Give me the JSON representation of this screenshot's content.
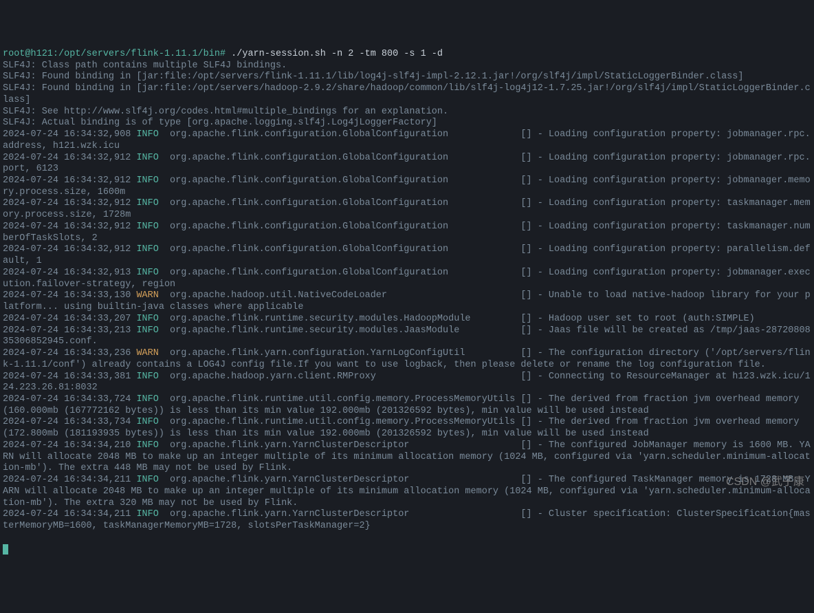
{
  "prompt_prefix": "root@h121:/opt/servers/flink-1.11.1/bin# ",
  "prompt_cmd": "./yarn-session.sh -n 2 -tm 800 -s 1 -d",
  "slf4j": [
    "SLF4J: Class path contains multiple SLF4J bindings.",
    "SLF4J: Found binding in [jar:file:/opt/servers/flink-1.11.1/lib/log4j-slf4j-impl-2.12.1.jar!/org/slf4j/impl/StaticLoggerBinder.class]",
    "SLF4J: Found binding in [jar:file:/opt/servers/hadoop-2.9.2/share/hadoop/common/lib/slf4j-log4j12-1.7.25.jar!/org/slf4j/impl/StaticLoggerBinder.class]",
    "SLF4J: See http://www.slf4j.org/codes.html#multiple_bindings for an explanation.",
    "SLF4J: Actual binding is of type [org.apache.logging.slf4j.Log4jLoggerFactory]"
  ],
  "logs": [
    {
      "ts": "2024-07-24 16:34:32,908",
      "lvl": "INFO",
      "logger": "org.apache.flink.configuration.GlobalConfiguration",
      "msg": "[] - Loading configuration property: jobmanager.rpc.address, h121.wzk.icu"
    },
    {
      "ts": "2024-07-24 16:34:32,912",
      "lvl": "INFO",
      "logger": "org.apache.flink.configuration.GlobalConfiguration",
      "msg": "[] - Loading configuration property: jobmanager.rpc.port, 6123"
    },
    {
      "ts": "2024-07-24 16:34:32,912",
      "lvl": "INFO",
      "logger": "org.apache.flink.configuration.GlobalConfiguration",
      "msg": "[] - Loading configuration property: jobmanager.memory.process.size, 1600m"
    },
    {
      "ts": "2024-07-24 16:34:32,912",
      "lvl": "INFO",
      "logger": "org.apache.flink.configuration.GlobalConfiguration",
      "msg": "[] - Loading configuration property: taskmanager.memory.process.size, 1728m"
    },
    {
      "ts": "2024-07-24 16:34:32,912",
      "lvl": "INFO",
      "logger": "org.apache.flink.configuration.GlobalConfiguration",
      "msg": "[] - Loading configuration property: taskmanager.numberOfTaskSlots, 2"
    },
    {
      "ts": "2024-07-24 16:34:32,912",
      "lvl": "INFO",
      "logger": "org.apache.flink.configuration.GlobalConfiguration",
      "msg": "[] - Loading configuration property: parallelism.default, 1"
    },
    {
      "ts": "2024-07-24 16:34:32,913",
      "lvl": "INFO",
      "logger": "org.apache.flink.configuration.GlobalConfiguration",
      "msg": "[] - Loading configuration property: jobmanager.execution.failover-strategy, region"
    },
    {
      "ts": "2024-07-24 16:34:33,130",
      "lvl": "WARN",
      "logger": "org.apache.hadoop.util.NativeCodeLoader",
      "msg": "[] - Unable to load native-hadoop library for your platform... using builtin-java classes where applicable"
    },
    {
      "ts": "2024-07-24 16:34:33,207",
      "lvl": "INFO",
      "logger": "org.apache.flink.runtime.security.modules.HadoopModule",
      "msg": "[] - Hadoop user set to root (auth:SIMPLE)"
    },
    {
      "ts": "2024-07-24 16:34:33,213",
      "lvl": "INFO",
      "logger": "org.apache.flink.runtime.security.modules.JaasModule",
      "msg": "[] - Jaas file will be created as /tmp/jaas-2872080835306852945.conf."
    },
    {
      "ts": "2024-07-24 16:34:33,236",
      "lvl": "WARN",
      "logger": "org.apache.flink.yarn.configuration.YarnLogConfigUtil",
      "msg": "[] - The configuration directory ('/opt/servers/flink-1.11.1/conf') already contains a LOG4J config file.If you want to use logback, then please delete or rename the log configuration file."
    },
    {
      "ts": "2024-07-24 16:34:33,381",
      "lvl": "INFO",
      "logger": "org.apache.hadoop.yarn.client.RMProxy",
      "msg": "[] - Connecting to ResourceManager at h123.wzk.icu/124.223.26.81:8032"
    },
    {
      "ts": "2024-07-24 16:34:33,724",
      "lvl": "INFO",
      "logger": "org.apache.flink.runtime.util.config.memory.ProcessMemoryUtils",
      "msg": "[] - The derived from fraction jvm overhead memory (160.000mb (167772162 bytes)) is less than its min value 192.000mb (201326592 bytes), min value will be used instead"
    },
    {
      "ts": "2024-07-24 16:34:33,734",
      "lvl": "INFO",
      "logger": "org.apache.flink.runtime.util.config.memory.ProcessMemoryUtils",
      "msg": "[] - The derived from fraction jvm overhead memory (172.800mb (181193935 bytes)) is less than its min value 192.000mb (201326592 bytes), min value will be used instead"
    },
    {
      "ts": "2024-07-24 16:34:34,210",
      "lvl": "INFO",
      "logger": "org.apache.flink.yarn.YarnClusterDescriptor",
      "msg": "[] - The configured JobManager memory is 1600 MB. YARN will allocate 2048 MB to make up an integer multiple of its minimum allocation memory (1024 MB, configured via 'yarn.scheduler.minimum-allocation-mb'). The extra 448 MB may not be used by Flink."
    },
    {
      "ts": "2024-07-24 16:34:34,211",
      "lvl": "INFO",
      "logger": "org.apache.flink.yarn.YarnClusterDescriptor",
      "msg": "[] - The configured TaskManager memory is 1728 MB. YARN will allocate 2048 MB to make up an integer multiple of its minimum allocation memory (1024 MB, configured via 'yarn.scheduler.minimum-allocation-mb'). The extra 320 MB may not be used by Flink."
    },
    {
      "ts": "2024-07-24 16:34:34,211",
      "lvl": "INFO",
      "logger": "org.apache.flink.yarn.YarnClusterDescriptor",
      "msg": "[] - Cluster specification: ClusterSpecification{masterMemoryMB=1600, taskManagerMemoryMB=1728, slotsPerTaskManager=2}"
    }
  ],
  "watermark": "CSDN @武子康"
}
